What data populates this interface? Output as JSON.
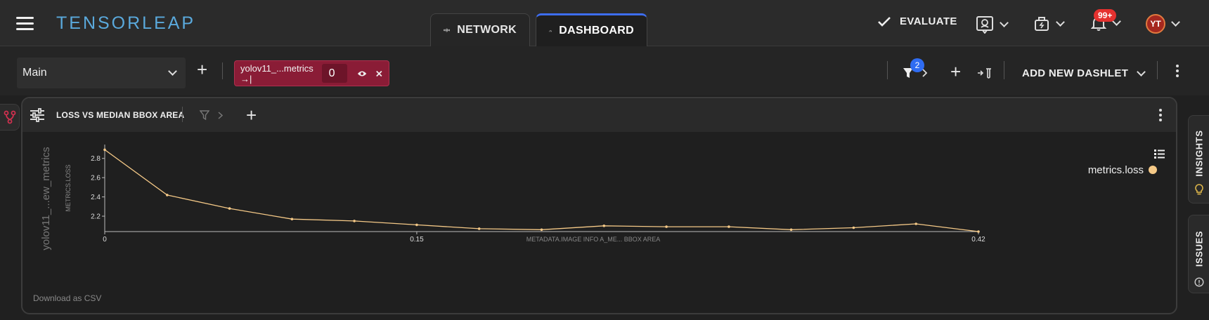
{
  "app": {
    "logo": "TENSORLEAP"
  },
  "tabs": [
    {
      "label": "NETWORK",
      "icon": "network-icon"
    },
    {
      "label": "DASHBOARD",
      "icon": "gauge-icon",
      "active": true
    }
  ],
  "header": {
    "evaluate_label": "EVALUATE",
    "notifications_badge": "99+",
    "avatar_initials": "YT"
  },
  "toolbar": {
    "dashboard_select": "Main",
    "chip": {
      "label": "yolov11_...metrics →|",
      "value": "0"
    },
    "filter_count": "2",
    "add_dashlet_label": "ADD NEW DASHLET"
  },
  "dashlet": {
    "title": "LOSS VS MEDIAN BBOX AREA",
    "download_label": "Download as CSV",
    "outer_ylabel": "yolov11_...ew_metrics"
  },
  "side_tabs": [
    {
      "label": "INSIGHTS"
    },
    {
      "label": "ISSUES"
    }
  ],
  "colors": {
    "accent": "#3d6df0",
    "chip": "#8a1c36",
    "series": "#f5c987",
    "badge": "#e5312f"
  },
  "chart_data": {
    "type": "line",
    "ylabel": "METRICS.LOSS",
    "xlabel": "METADATA.IMAGE INFO A_ME... BBOX AREA",
    "xlim": [
      0,
      0.42
    ],
    "ylim": [
      2.04,
      2.9
    ],
    "x_ticks": [
      {
        "value": 0,
        "label": "0"
      },
      {
        "value": 0.15,
        "label": "0.15"
      },
      {
        "value": 0.42,
        "label": "0.42"
      }
    ],
    "y_ticks": [
      {
        "value": 2.2,
        "label": "2.2"
      },
      {
        "value": 2.4,
        "label": "2.4"
      },
      {
        "value": 2.6,
        "label": "2.6"
      },
      {
        "value": 2.8,
        "label": "2.8"
      }
    ],
    "series": [
      {
        "name": "metrics.loss",
        "color": "#f5c987",
        "points": [
          [
            0.0,
            2.89
          ],
          [
            0.03,
            2.42
          ],
          [
            0.06,
            2.28
          ],
          [
            0.09,
            2.17
          ],
          [
            0.12,
            2.15
          ],
          [
            0.15,
            2.11
          ],
          [
            0.18,
            2.07
          ],
          [
            0.21,
            2.06
          ],
          [
            0.24,
            2.1
          ],
          [
            0.27,
            2.09
          ],
          [
            0.3,
            2.09
          ],
          [
            0.33,
            2.06
          ],
          [
            0.36,
            2.08
          ],
          [
            0.39,
            2.12
          ],
          [
            0.42,
            2.04
          ]
        ]
      }
    ]
  }
}
